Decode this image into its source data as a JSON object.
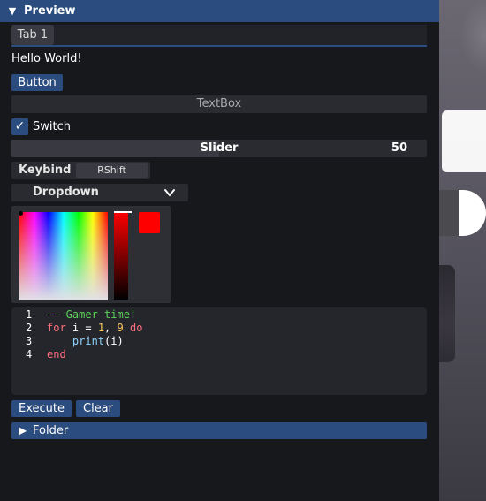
{
  "window": {
    "title": "Preview",
    "collapse_icon": "▼"
  },
  "tabs": [
    {
      "label": "Tab 1"
    }
  ],
  "label_text": "Hello World!",
  "button_label": "Button",
  "textbox": {
    "placeholder": "TextBox",
    "value": ""
  },
  "switch": {
    "label": "Switch",
    "checked": true,
    "check_glyph": "✓"
  },
  "slider": {
    "label": "Slider",
    "value": "50",
    "fraction": 0.5
  },
  "keybind": {
    "label": "Keybind",
    "key": "RShift"
  },
  "dropdown": {
    "label": "Dropdown",
    "selected": ""
  },
  "colorpicker": {
    "selected_color": "#ff0000",
    "hue": 0,
    "value": 1.0
  },
  "code_editor": {
    "line_numbers": [
      "1",
      "2",
      "3",
      "4"
    ],
    "lines": [
      [
        {
          "text": "-- Gamer time!",
          "kind": "comment"
        }
      ],
      [
        {
          "text": "for",
          "kind": "kw"
        },
        {
          "text": " i = ",
          "kind": "id"
        },
        {
          "text": "1",
          "kind": "num"
        },
        {
          "text": ", ",
          "kind": "id"
        },
        {
          "text": "9",
          "kind": "num"
        },
        {
          "text": " ",
          "kind": "id"
        },
        {
          "text": "do",
          "kind": "kw"
        }
      ],
      [
        {
          "text": "    ",
          "kind": "id"
        },
        {
          "text": "print",
          "kind": "fn"
        },
        {
          "text": "(i)",
          "kind": "id"
        }
      ],
      [
        {
          "text": "end",
          "kind": "kw"
        }
      ]
    ]
  },
  "actions": {
    "execute_label": "Execute",
    "clear_label": "Clear"
  },
  "folder": {
    "label": "Folder",
    "icon": "▶"
  },
  "colors": {
    "accent": "#2b4c7f",
    "background": "#17181c",
    "control": "#2a2b31"
  }
}
